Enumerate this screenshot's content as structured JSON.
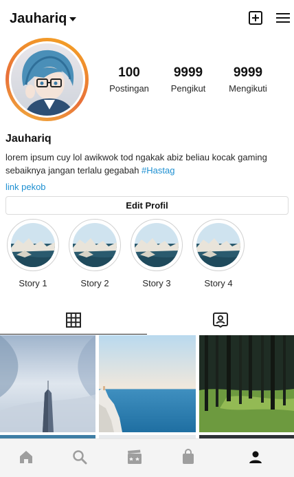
{
  "header": {
    "username": "Jauhariq"
  },
  "stats": [
    {
      "value": "100",
      "label": "Postingan"
    },
    {
      "value": "9999",
      "label": "Pengikut"
    },
    {
      "value": "9999",
      "label": "Mengikuti"
    }
  ],
  "profile": {
    "display_name": "Jauhariq",
    "bio_text": "lorem ipsum cuy lol awikwok tod ngakak abiz beliau kocak gaming sebaiknya jangan terlalu gegabah ",
    "hashtag": "#Hastag",
    "link": "link pekob",
    "edit_label": "Edit Profil"
  },
  "stories": [
    {
      "label": "Story 1"
    },
    {
      "label": "Story 2"
    },
    {
      "label": "Story 3"
    },
    {
      "label": "Story 4"
    }
  ],
  "tabs": {
    "active": "grid",
    "items": [
      {
        "icon": "grid-icon"
      },
      {
        "icon": "tagged-icon"
      }
    ]
  },
  "bottom_nav": {
    "active": "profile",
    "items": [
      {
        "icon": "home-icon"
      },
      {
        "icon": "search-icon"
      },
      {
        "icon": "reels-icon"
      },
      {
        "icon": "shop-icon"
      },
      {
        "icon": "profile-icon"
      }
    ]
  },
  "colors": {
    "link": "#1d8fd1",
    "ring_gradient": [
      "#f5a623",
      "#e8703a"
    ],
    "nav_background": "#f4f4f4"
  }
}
